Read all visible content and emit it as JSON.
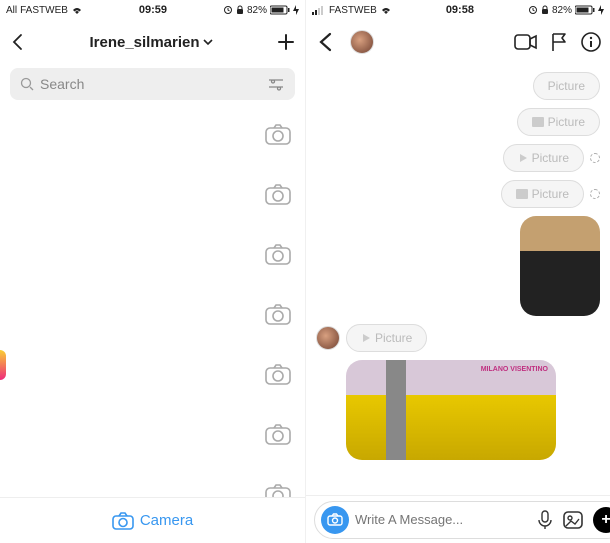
{
  "left": {
    "status": {
      "carrier": "FASTWEB",
      "time": "09:59",
      "battery": "82%",
      "signal": "All"
    },
    "header": {
      "username": "Irene_silmarien"
    },
    "search": {
      "placeholder": "Search"
    },
    "footer": {
      "camera_label": "Camera"
    }
  },
  "right": {
    "status": {
      "carrier": "FASTWEB",
      "time": "09:58",
      "battery": "82%"
    },
    "messages": {
      "pic": "Picture",
      "location_tag": "MILANO VISENTINO"
    },
    "composer": {
      "placeholder": "Write A Message..."
    }
  }
}
